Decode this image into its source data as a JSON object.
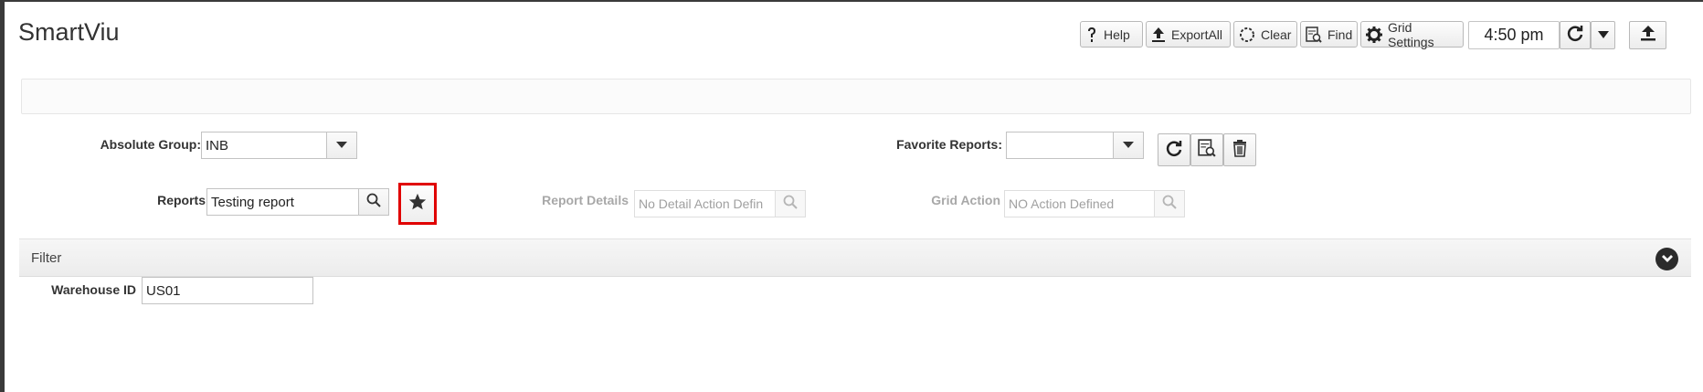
{
  "app": {
    "title": "SmartViu"
  },
  "toolbar": {
    "help": "Help",
    "export_all": "ExportAll",
    "clear": "Clear",
    "find": "Find",
    "grid_settings": "Grid Settings",
    "time": "4:50 pm"
  },
  "form": {
    "absolute_group": {
      "label": "Absolute Group:",
      "value": "INB"
    },
    "favorite_reports": {
      "label": "Favorite Reports:",
      "value": ""
    },
    "reports": {
      "label": "Reports",
      "value": "Testing report"
    },
    "report_details": {
      "label": "Report Details",
      "placeholder": "No Detail Action Defin"
    },
    "grid_action": {
      "label": "Grid Action",
      "placeholder": "NO Action Defined"
    }
  },
  "filter": {
    "title": "Filter",
    "warehouse_id": {
      "label": "Warehouse ID",
      "value": "US01"
    }
  },
  "colors": {
    "highlight": "#e00000",
    "toggle": "#2b2b2b"
  }
}
